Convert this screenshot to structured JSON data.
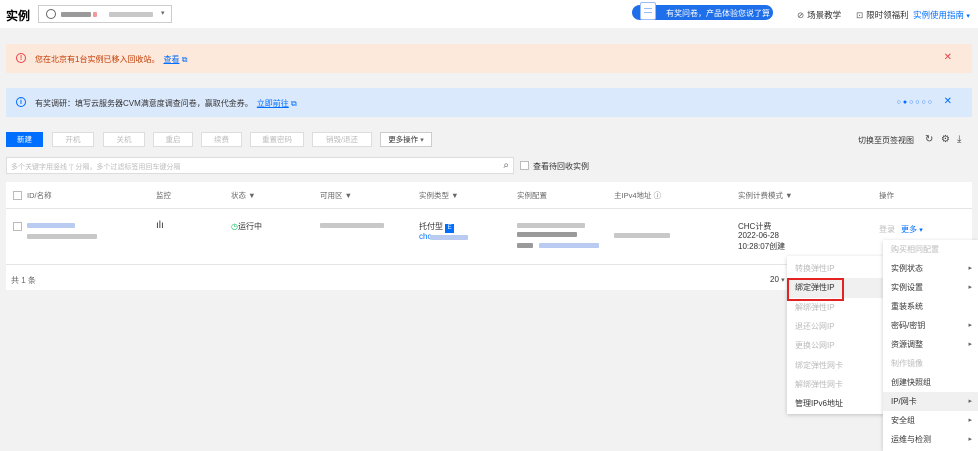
{
  "header": {
    "title": "实例",
    "survey_text": "有奖问卷，产品体验您说了算",
    "nav": [
      {
        "icon": "tour-icon",
        "label": "场景教学"
      },
      {
        "icon": "gift-icon",
        "label": "限时领福利"
      },
      {
        "icon": "",
        "label": "实例使用指南"
      }
    ]
  },
  "alerts": {
    "recycle": {
      "text": "您在北京有1台实例已移入回收站。",
      "link": "查看"
    },
    "survey": {
      "text": "有奖调研：填写云服务器CVM满意度调查问卷，赢取代金券。",
      "link": "立即前往"
    }
  },
  "toolbar": {
    "buttons": [
      "新建",
      "开机",
      "关机",
      "重启",
      "续费",
      "重置密码",
      "销毁/退还",
      "更多操作"
    ],
    "switch_view": "切换至页签视图"
  },
  "search": {
    "placeholder": "多个关键字用竖线 '|' 分隔，多个过滤标签用回车键分隔",
    "show_recycle": "查看待回收实例"
  },
  "table": {
    "columns": [
      "ID/名称",
      "监控",
      "状态",
      "可用区",
      "实例类型",
      "实例配置",
      "主IPv4地址",
      "实例计费模式",
      "操作"
    ],
    "row": {
      "status": "运行中",
      "instance_type": "托付型",
      "instance_type_sub": "chc",
      "billing": "CHC计费",
      "created_date": "2022-06-28",
      "created_time": "10:28:07创建",
      "action_login": "登录",
      "action_more": "更多"
    },
    "total": "共 1 条",
    "page_size": "20"
  },
  "more_menu": {
    "items": [
      {
        "label": "购买相同配置",
        "disabled": true,
        "submenu": false
      },
      {
        "label": "实例状态",
        "disabled": false,
        "submenu": true
      },
      {
        "label": "实例设置",
        "disabled": false,
        "submenu": true
      },
      {
        "label": "重装系统",
        "disabled": false,
        "submenu": false
      },
      {
        "label": "密码/密钥",
        "disabled": false,
        "submenu": true
      },
      {
        "label": "资源调整",
        "disabled": false,
        "submenu": true
      },
      {
        "label": "制作镜像",
        "disabled": true,
        "submenu": false
      },
      {
        "label": "创建快照组",
        "disabled": false,
        "submenu": false
      },
      {
        "label": "IP/网卡",
        "disabled": false,
        "submenu": true,
        "active": true
      },
      {
        "label": "安全组",
        "disabled": false,
        "submenu": true
      },
      {
        "label": "运维与检测",
        "disabled": false,
        "submenu": true
      }
    ]
  },
  "ip_submenu": {
    "items": [
      {
        "label": "转换弹性IP",
        "disabled": true
      },
      {
        "label": "绑定弹性IP",
        "disabled": false,
        "highlighted": true
      },
      {
        "label": "解绑弹性IP",
        "disabled": true
      },
      {
        "label": "退还公网IP",
        "disabled": true
      },
      {
        "label": "更换公网IP",
        "disabled": true
      },
      {
        "label": "绑定弹性网卡",
        "disabled": true
      },
      {
        "label": "解绑弹性网卡",
        "disabled": true
      },
      {
        "label": "管理IPv6地址",
        "disabled": false
      }
    ]
  }
}
